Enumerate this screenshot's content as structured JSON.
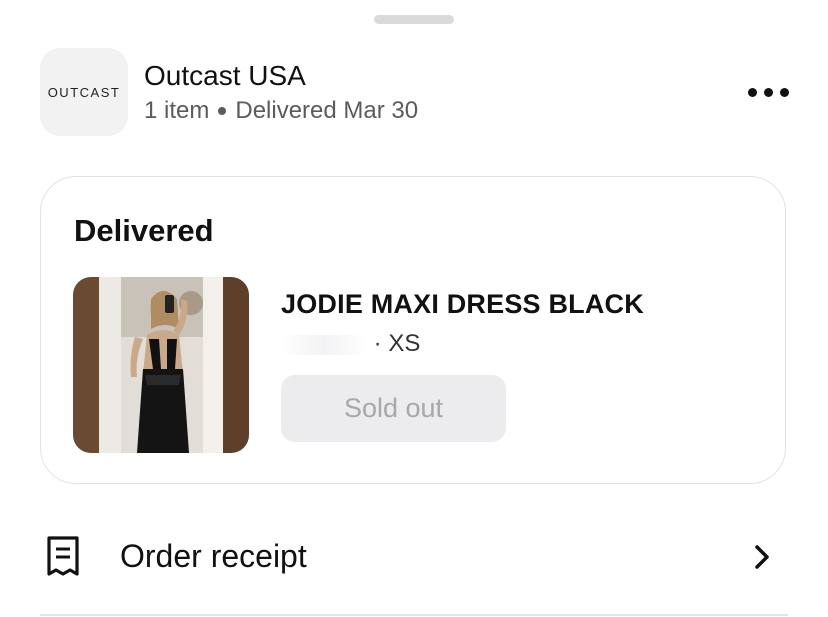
{
  "store": {
    "logo_text": "OUTCAST",
    "name": "Outcast USA",
    "item_count": "1 item",
    "delivery_status": "Delivered Mar 30"
  },
  "order_card": {
    "status_heading": "Delivered",
    "product": {
      "title": "JODIE MAXI DRESS BLACK",
      "variant_separator": "· ",
      "size": "XS",
      "image_icon": "product-photo-black-maxi-dress",
      "button_label": "Sold out"
    }
  },
  "receipt": {
    "label": "Order receipt",
    "icon": "receipt-icon",
    "chevron": "chevron-right-icon"
  },
  "colors": {
    "text_primary": "#111111",
    "text_secondary": "#5b5b5f",
    "disabled_button_bg": "#ececee",
    "disabled_button_text": "#a7a7ac",
    "card_border": "#e3e3e6"
  }
}
